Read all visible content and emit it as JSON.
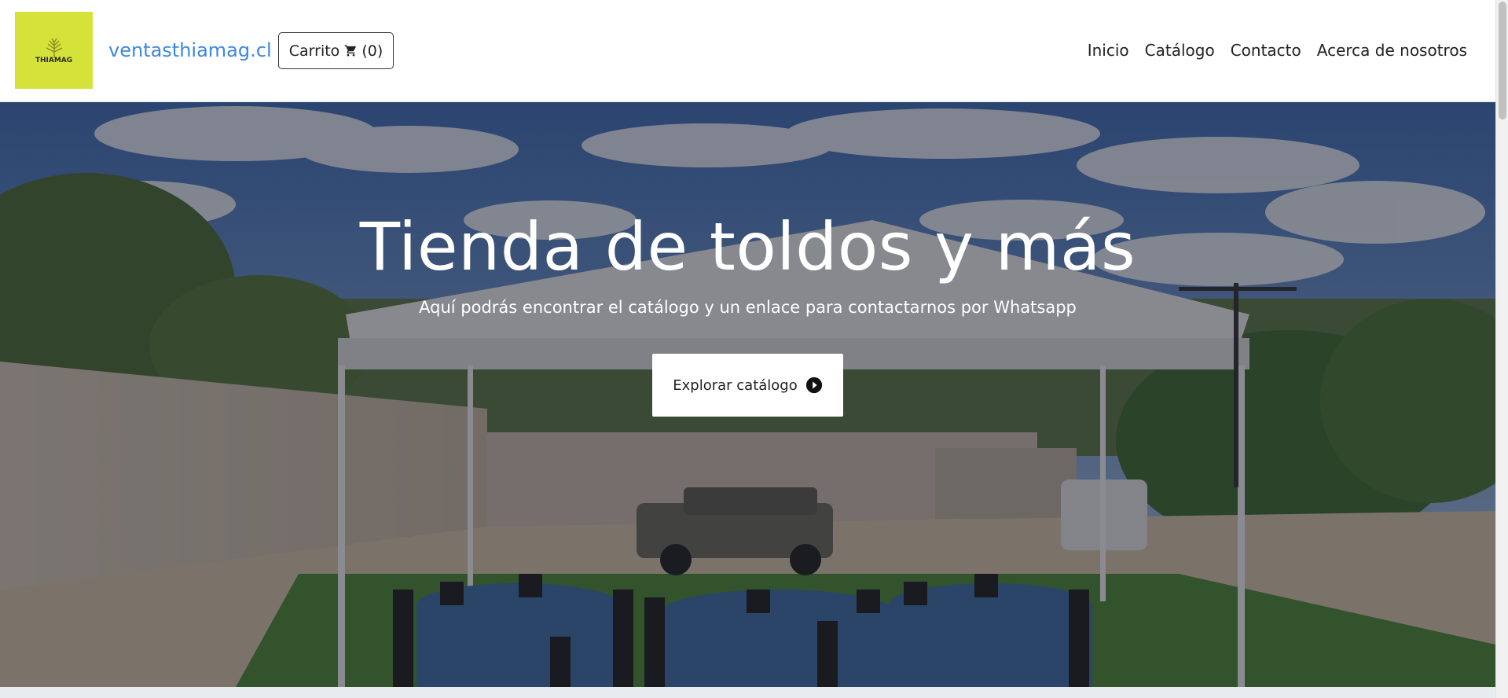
{
  "header": {
    "logo_text": "THIAMAG",
    "brand": "ventasthiamag.cl",
    "cart_label": "Carrito",
    "cart_count": "(0)",
    "cart_icon": "cart-icon",
    "nav": [
      "Inicio",
      "Catálogo",
      "Contacto",
      "Acerca de nosotros"
    ]
  },
  "hero": {
    "title": "Tienda de toldos y más",
    "subtitle": "Aquí podrás encontrar el catálogo y un enlace para contactarnos por Whatsapp",
    "button_label": "Explorar catálogo",
    "button_icon": "play-circle-icon"
  },
  "colors": {
    "brand": "#3c86e0",
    "logo_bg": "#d4e23a"
  }
}
